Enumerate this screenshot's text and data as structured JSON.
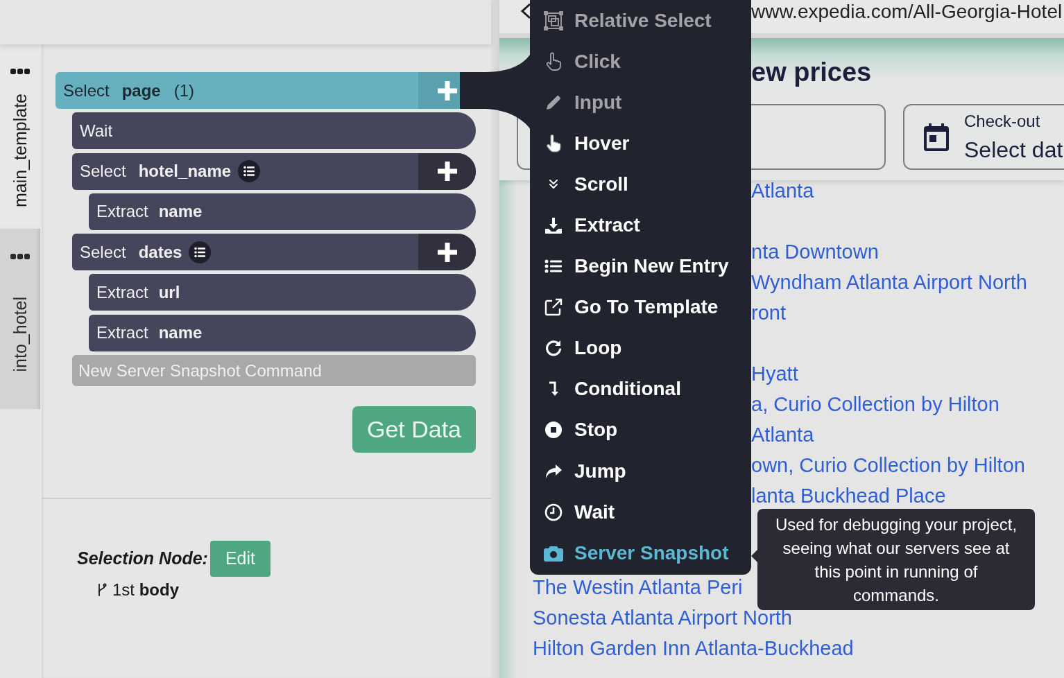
{
  "workflow_tabs": [
    {
      "label": "main_template",
      "selected": true
    },
    {
      "label": "into_hotel",
      "selected": false
    }
  ],
  "commands": [
    {
      "kind": "select",
      "action": "Select",
      "target": "page",
      "count": "(1)",
      "list": false,
      "selected": true,
      "children": [
        {
          "kind": "action",
          "action": "Wait",
          "selected": false
        },
        {
          "kind": "select",
          "action": "Select",
          "target": "hotel_name",
          "list": true,
          "selected": false,
          "children": [
            {
              "kind": "action",
              "action": "Extract",
              "target": "name",
              "selected": false
            }
          ]
        },
        {
          "kind": "select",
          "action": "Select",
          "target": "dates",
          "list": true,
          "selected": false,
          "children": [
            {
              "kind": "action",
              "action": "Extract",
              "target": "url",
              "selected": false
            },
            {
              "kind": "action",
              "action": "Extract",
              "target": "name",
              "selected": false
            }
          ]
        },
        {
          "kind": "pending",
          "label": "New Server Snapshot Command",
          "selected": false
        }
      ]
    }
  ],
  "get_data_button": "Get Data",
  "selection_node": {
    "label": "Selection Node:",
    "edit_button": "Edit",
    "path": "1st **body**"
  },
  "command_menu": {
    "items": [
      {
        "label": "Relative Select",
        "disabled": true,
        "selected": false
      },
      {
        "label": "Click",
        "disabled": true,
        "selected": false
      },
      {
        "label": "Input",
        "disabled": true,
        "selected": false
      },
      {
        "label": "Hover",
        "disabled": false,
        "selected": false
      },
      {
        "label": "Scroll",
        "disabled": false,
        "selected": false
      },
      {
        "label": "Extract",
        "disabled": false,
        "selected": false
      },
      {
        "label": "Begin New Entry",
        "disabled": false,
        "selected": false
      },
      {
        "label": "Go To Template",
        "disabled": false,
        "selected": false
      },
      {
        "label": "Loop",
        "disabled": false,
        "selected": false
      },
      {
        "label": "Conditional",
        "disabled": false,
        "selected": false
      },
      {
        "label": "Stop",
        "disabled": false,
        "selected": false
      },
      {
        "label": "Jump",
        "disabled": false,
        "selected": false
      },
      {
        "label": "Wait",
        "disabled": false,
        "selected": false
      },
      {
        "label": "Server Snapshot",
        "disabled": false,
        "selected": true
      }
    ]
  },
  "tooltip": "Used for debugging your project, seeing what our servers see at this point in running of commands.",
  "browser": {
    "url": "www.expedia.com/All-Georgia-Hotel",
    "heading": "ew prices",
    "fields": [
      {
        "kind": "text"
      },
      {
        "kind": "date",
        "label": "Check-out",
        "value": "Select dat"
      }
    ],
    "links": [
      {
        "kind": "clipped",
        "text": "Atlanta"
      },
      {
        "kind": "covered"
      },
      {
        "kind": "clipped",
        "text": "nta Downtown"
      },
      {
        "kind": "clipped",
        "text": "Wyndham Atlanta Airport North"
      },
      {
        "kind": "clipped",
        "text": "ront"
      },
      {
        "kind": "covered"
      },
      {
        "kind": "clipped",
        "text": "Hyatt"
      },
      {
        "kind": "clipped",
        "text": "a, Curio Collection by Hilton"
      },
      {
        "kind": "clipped",
        "text": "Atlanta"
      },
      {
        "kind": "clipped",
        "text": "own, Curio Collection by Hilton"
      },
      {
        "kind": "clipped",
        "text": "lanta Buckhead Place"
      },
      {
        "kind": "covered"
      },
      {
        "kind": "covered"
      },
      {
        "kind": "full",
        "text": "The Westin Atlanta Peri"
      },
      {
        "kind": "full",
        "text": "Sonesta Atlanta Airport North"
      },
      {
        "kind": "full",
        "text": "Hilton Garden Inn Atlanta-Buckhead"
      }
    ]
  }
}
